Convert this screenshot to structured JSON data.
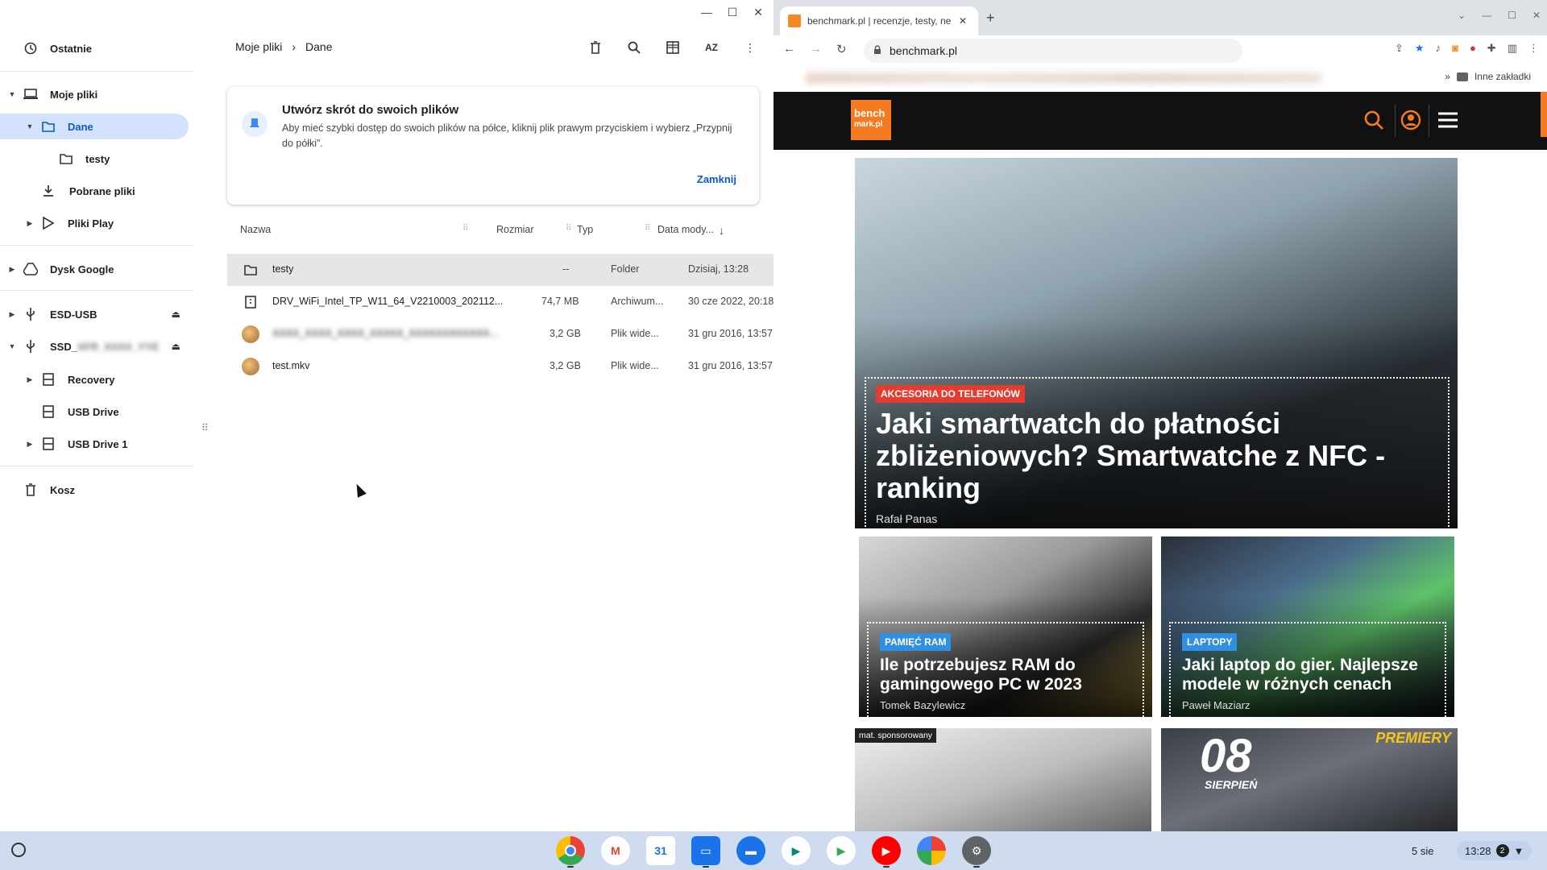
{
  "files_app": {
    "sidebar": {
      "recent": "Ostatnie",
      "my_files": "Moje pliki",
      "dane": "Dane",
      "testy": "testy",
      "downloads": "Pobrane pliki",
      "play_files": "Pliki Play",
      "google_drive": "Dysk Google",
      "esd_usb": "ESD-USB",
      "ssd": "SSD_",
      "ssd_blurred_suffix": "XFR_XXXX_YYE",
      "recovery": "Recovery",
      "usb_drive": "USB Drive",
      "usb_drive_1": "USB Drive 1",
      "trash": "Kosz"
    },
    "breadcrumb": {
      "root": "Moje pliki",
      "current": "Dane"
    },
    "toolbar_icons": {
      "delete": "trash-icon",
      "search": "search-icon",
      "grid": "grid-icon",
      "sort": "AZ",
      "more": "more-icon"
    },
    "tip_card": {
      "title": "Utwórz skrót do swoich plików",
      "text": "Aby mieć szybki dostęp do swoich plików na półce, kliknij plik prawym przyciskiem i wybierz „Przypnij do półki”.",
      "close": "Zamknij"
    },
    "columns": {
      "name": "Nazwa",
      "size": "Rozmiar",
      "type": "Typ",
      "modified": "Data mody..."
    },
    "rows": [
      {
        "name": "testy",
        "size": "--",
        "type": "Folder",
        "modified": "Dzisiaj, 13:28",
        "icon": "folder-icon"
      },
      {
        "name": "DRV_WiFi_Intel_TP_W11_64_V2210003_202112...",
        "size": "74,7 MB",
        "type": "Archiwum...",
        "modified": "30 cze 2022, 20:18",
        "icon": "archive-icon"
      },
      {
        "name": "XXXX_XXXX_XXXX_XXXXX_XXXXXXXXXXXX...",
        "size": "3,2 GB",
        "type": "Plik wide...",
        "modified": "31 gru 2016, 13:57",
        "icon": "video-thumbnail"
      },
      {
        "name": "test.mkv",
        "size": "3,2 GB",
        "type": "Plik wide...",
        "modified": "31 gru 2016, 13:57",
        "icon": "video-thumbnail"
      }
    ]
  },
  "browser": {
    "tab_title": "benchmark.pl | recenzje, testy, ne",
    "url": "benchmark.pl",
    "bookmarks_other": "Inne zakładki",
    "site": {
      "logo_line1": "bench",
      "logo_line2": "mark.pl",
      "hero": {
        "category": "AKCESORIA DO TELEFONÓW",
        "title": "Jaki smartwatch do płatności zbliżeniowych? Smartwatche z NFC - ranking",
        "author": "Rafał Panas"
      },
      "card_ram": {
        "category": "PAMIĘĆ RAM",
        "title": "Ile potrzebujesz RAM do gamingowego PC w 2023",
        "author": "Tomek Bazylewicz"
      },
      "card_laptop": {
        "category": "LAPTOPY",
        "title": "Jaki laptop do gier. Najlepsze modele w różnych cenach",
        "author": "Paweł Maziarz"
      },
      "sponsored_label": "mat. sponsorowany",
      "premiere_label": "PREMIERY",
      "premiere_day": "08",
      "premiere_month": "SIERPIEŃ"
    }
  },
  "shelf": {
    "date": "5 sie",
    "time": "13:28",
    "notifications": "2"
  },
  "colors": {
    "accent": "#0b57d0",
    "brand": "#f47b20",
    "shelf": "#cfdcef"
  }
}
